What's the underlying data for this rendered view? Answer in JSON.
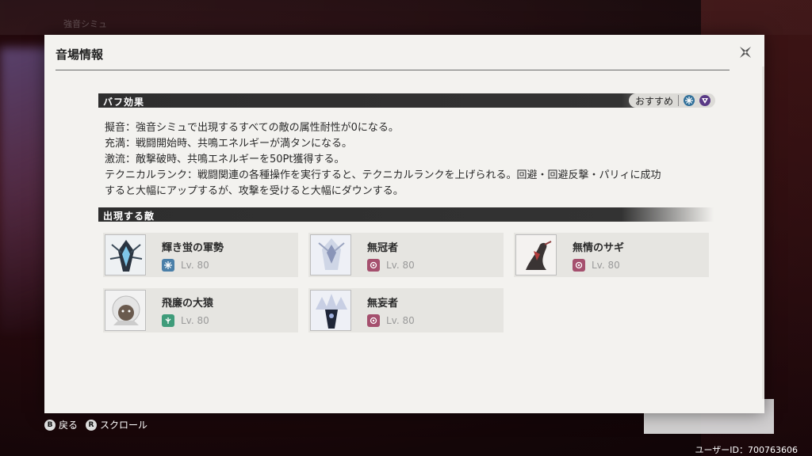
{
  "background": {
    "label": "強音シミュ"
  },
  "panel": {
    "title": "音場情報"
  },
  "buff": {
    "heading": "バフ効果",
    "recommend_label": "おすすめ",
    "recommend_icons": [
      "glacio-icon",
      "havoc-icon"
    ],
    "lines": [
      "擬音：強音シミュで出現するすべての敵の属性耐性が0になる。",
      "充満：戦闘開始時、共鳴エネルギーが満タンになる。",
      "激流：敵撃破時、共鳴エネルギーを50Pt獲得する。",
      "テクニカルランク：戦闘関連の各種操作を実行すると、テクニカルランクを上げられる。回避・回避反撃・パリィに成功",
      "すると大幅にアップするが、攻撃を受けると大幅にダウンする。"
    ]
  },
  "enemies": {
    "heading": "出現する敵",
    "list": [
      {
        "name": "輝き蛍の軍勢",
        "level": "Lv. 80",
        "attribute": "glacio-icon",
        "attr_color": "#4a7fa8"
      },
      {
        "name": "無冠者",
        "level": "Lv. 80",
        "attribute": "havoc-icon",
        "attr_color": "#a5506e"
      },
      {
        "name": "無情のサギ",
        "level": "Lv. 80",
        "attribute": "havoc-icon",
        "attr_color": "#a5506e"
      },
      {
        "name": "飛廉の大猿",
        "level": "Lv. 80",
        "attribute": "aero-icon",
        "attr_color": "#3f9c7a"
      },
      {
        "name": "無妄者",
        "level": "Lv. 80",
        "attribute": "havoc-icon",
        "attr_color": "#a5506e"
      }
    ]
  },
  "footer": {
    "back_glyph": "B",
    "back_label": "戻る",
    "scroll_glyph": "R",
    "scroll_label": "スクロール",
    "user_id": "ユーザーID：700763606"
  }
}
